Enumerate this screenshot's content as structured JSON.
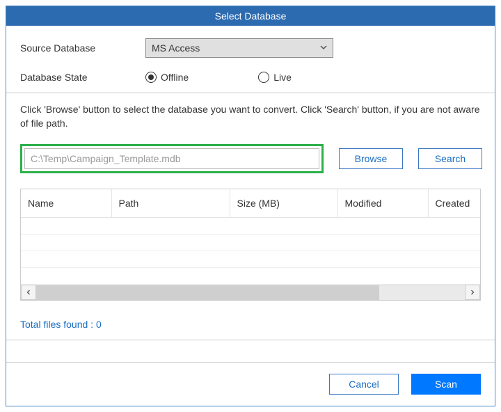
{
  "title": "Select Database",
  "form": {
    "source_label": "Source Database",
    "source_value": "MS Access",
    "state_label": "Database State",
    "radio_offline": "Offline",
    "radio_live": "Live"
  },
  "instruction": "Click 'Browse' button to select the database you want to convert. Click 'Search' button, if you are not aware of file path.",
  "path_value": "C:\\Temp\\Campaign_Template.mdb",
  "buttons": {
    "browse": "Browse",
    "search": "Search",
    "cancel": "Cancel",
    "scan": "Scan"
  },
  "table": {
    "col_name": "Name",
    "col_path": "Path",
    "col_size": "Size (MB)",
    "col_modified": "Modified",
    "col_created": "Created"
  },
  "total_files": "Total files found : 0"
}
